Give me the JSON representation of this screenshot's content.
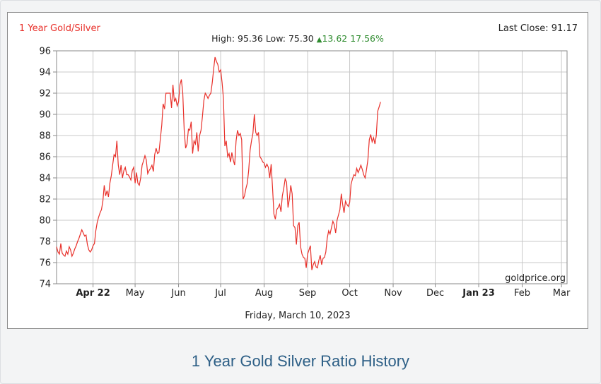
{
  "colors": {
    "line": "#e8302a",
    "grid": "#c8c8c8",
    "up": "#2e8b2e",
    "title": "#e8302a",
    "caption": "#2d5f86"
  },
  "header": {
    "title": "1 Year Gold/Silver",
    "last_close_label": "Last Close:",
    "last_close_value": "91.17",
    "high_label": "High:",
    "high_value": "95.36",
    "low_label": "Low:",
    "low_value": "75.30",
    "change_arrow": "▲",
    "change_value": "13.62",
    "change_pct": "17.56%"
  },
  "watermark": "goldprice.org",
  "date_label": "Friday, March 10, 2023",
  "caption": "1 Year Gold Silver Ratio History",
  "chart_data": {
    "type": "line",
    "title": "1 Year Gold/Silver",
    "xlabel": "Friday, March 10, 2023",
    "ylabel": "",
    "ylim": [
      74,
      96
    ],
    "yticks": [
      74,
      76,
      78,
      80,
      82,
      84,
      86,
      88,
      90,
      92,
      94,
      96
    ],
    "xlim": [
      0,
      364
    ],
    "xtick_labels": [
      {
        "label": "Apr 22",
        "day": 26,
        "bold": true
      },
      {
        "label": "May",
        "day": 56,
        "bold": false
      },
      {
        "label": "Jun",
        "day": 87,
        "bold": false
      },
      {
        "label": "Jul",
        "day": 117,
        "bold": false
      },
      {
        "label": "Aug",
        "day": 148,
        "bold": false
      },
      {
        "label": "Sep",
        "day": 179,
        "bold": false
      },
      {
        "label": "Oct",
        "day": 209,
        "bold": false
      },
      {
        "label": "Nov",
        "day": 240,
        "bold": false
      },
      {
        "label": "Dec",
        "day": 270,
        "bold": false
      },
      {
        "label": "Jan 23",
        "day": 301,
        "bold": true
      },
      {
        "label": "Feb",
        "day": 332,
        "bold": false
      },
      {
        "label": "Mar",
        "day": 360,
        "bold": false
      }
    ],
    "grid": true,
    "series": [
      {
        "points": [
          [
            0,
            77.5
          ],
          [
            1,
            77.0
          ],
          [
            2,
            76.8
          ],
          [
            3,
            77.8
          ],
          [
            4,
            76.9
          ],
          [
            5,
            76.7
          ],
          [
            6,
            76.6
          ],
          [
            7,
            77.1
          ],
          [
            8,
            76.8
          ],
          [
            9,
            77.5
          ],
          [
            10,
            77.2
          ],
          [
            11,
            76.6
          ],
          [
            12,
            76.9
          ],
          [
            13,
            77.3
          ],
          [
            14,
            77.6
          ],
          [
            15,
            78.0
          ],
          [
            16,
            78.3
          ],
          [
            17,
            78.7
          ],
          [
            18,
            79.1
          ],
          [
            19,
            78.8
          ],
          [
            20,
            78.5
          ],
          [
            21,
            78.6
          ],
          [
            22,
            77.7
          ],
          [
            23,
            77.2
          ],
          [
            24,
            77.0
          ],
          [
            25,
            77.2
          ],
          [
            26,
            77.6
          ],
          [
            27,
            77.8
          ],
          [
            28,
            79.0
          ],
          [
            29,
            79.8
          ],
          [
            30,
            80.3
          ],
          [
            31,
            80.7
          ],
          [
            32,
            81.0
          ],
          [
            33,
            81.8
          ],
          [
            34,
            83.3
          ],
          [
            35,
            82.3
          ],
          [
            36,
            82.8
          ],
          [
            37,
            82.2
          ],
          [
            38,
            83.5
          ],
          [
            39,
            84.2
          ],
          [
            40,
            85.2
          ],
          [
            41,
            86.2
          ],
          [
            42,
            86.0
          ],
          [
            43,
            87.5
          ],
          [
            44,
            85.2
          ],
          [
            45,
            84.3
          ],
          [
            46,
            85.2
          ],
          [
            47,
            84.0
          ],
          [
            48,
            84.7
          ],
          [
            49,
            85.0
          ],
          [
            50,
            84.3
          ],
          [
            51,
            84.3
          ],
          [
            52,
            84.1
          ],
          [
            53,
            83.8
          ],
          [
            54,
            84.7
          ],
          [
            55,
            85.0
          ],
          [
            56,
            83.5
          ],
          [
            57,
            84.5
          ],
          [
            58,
            83.5
          ],
          [
            59,
            83.3
          ],
          [
            60,
            84.0
          ],
          [
            61,
            85.2
          ],
          [
            62,
            85.6
          ],
          [
            63,
            86.1
          ],
          [
            64,
            85.7
          ],
          [
            65,
            84.4
          ],
          [
            66,
            84.7
          ],
          [
            67,
            84.9
          ],
          [
            68,
            85.2
          ],
          [
            69,
            84.6
          ],
          [
            70,
            86.2
          ],
          [
            71,
            86.8
          ],
          [
            72,
            86.3
          ],
          [
            73,
            86.4
          ],
          [
            74,
            87.7
          ],
          [
            75,
            89.0
          ],
          [
            76,
            91.0
          ],
          [
            77,
            90.5
          ],
          [
            78,
            92.0
          ],
          [
            79,
            92.0
          ],
          [
            80,
            92.0
          ],
          [
            81,
            92.0
          ],
          [
            82,
            90.6
          ],
          [
            83,
            92.8
          ],
          [
            84,
            91.2
          ],
          [
            85,
            91.5
          ],
          [
            86,
            90.8
          ],
          [
            87,
            91.2
          ],
          [
            88,
            92.8
          ],
          [
            89,
            93.3
          ],
          [
            90,
            92.0
          ],
          [
            91,
            88.5
          ],
          [
            92,
            86.8
          ],
          [
            93,
            87.2
          ],
          [
            94,
            88.6
          ],
          [
            95,
            88.5
          ],
          [
            96,
            89.3
          ],
          [
            97,
            86.3
          ],
          [
            98,
            87.5
          ],
          [
            99,
            87.2
          ],
          [
            100,
            88.3
          ],
          [
            101,
            86.5
          ],
          [
            102,
            88.0
          ],
          [
            103,
            88.5
          ],
          [
            104,
            89.8
          ],
          [
            105,
            91.3
          ],
          [
            106,
            92.0
          ],
          [
            107,
            91.8
          ],
          [
            108,
            91.5
          ],
          [
            109,
            91.8
          ],
          [
            110,
            92.0
          ],
          [
            111,
            93.0
          ],
          [
            112,
            94.3
          ],
          [
            113,
            95.4
          ],
          [
            114,
            95.0
          ],
          [
            115,
            94.7
          ],
          [
            116,
            94.0
          ],
          [
            117,
            94.2
          ],
          [
            118,
            93.0
          ],
          [
            119,
            91.5
          ],
          [
            120,
            87.0
          ],
          [
            121,
            87.5
          ],
          [
            122,
            86.0
          ],
          [
            123,
            86.3
          ],
          [
            124,
            85.5
          ],
          [
            125,
            86.4
          ],
          [
            126,
            85.7
          ],
          [
            127,
            85.2
          ],
          [
            128,
            87.5
          ],
          [
            129,
            88.5
          ],
          [
            130,
            88.0
          ],
          [
            131,
            88.2
          ],
          [
            132,
            87.6
          ],
          [
            133,
            82.0
          ],
          [
            134,
            82.3
          ],
          [
            135,
            83.0
          ],
          [
            136,
            83.5
          ],
          [
            137,
            84.7
          ],
          [
            138,
            86.6
          ],
          [
            139,
            87.5
          ],
          [
            140,
            88.2
          ],
          [
            141,
            90.0
          ],
          [
            142,
            88.3
          ],
          [
            143,
            88.0
          ],
          [
            144,
            88.3
          ],
          [
            145,
            86.0
          ],
          [
            146,
            85.8
          ],
          [
            147,
            85.5
          ],
          [
            148,
            85.4
          ],
          [
            149,
            85.0
          ],
          [
            150,
            85.3
          ],
          [
            151,
            85.0
          ],
          [
            152,
            84.0
          ],
          [
            153,
            85.3
          ],
          [
            154,
            83.0
          ],
          [
            155,
            80.6
          ],
          [
            156,
            80.1
          ],
          [
            157,
            81.0
          ],
          [
            158,
            81.2
          ],
          [
            159,
            81.5
          ],
          [
            160,
            80.8
          ],
          [
            161,
            82.3
          ],
          [
            162,
            83.0
          ],
          [
            163,
            83.9
          ],
          [
            164,
            83.6
          ],
          [
            165,
            81.2
          ],
          [
            166,
            82.0
          ],
          [
            167,
            83.3
          ],
          [
            168,
            82.5
          ],
          [
            169,
            79.5
          ],
          [
            170,
            79.3
          ],
          [
            171,
            77.7
          ],
          [
            172,
            79.5
          ],
          [
            173,
            79.8
          ],
          [
            174,
            77.5
          ],
          [
            175,
            76.8
          ],
          [
            176,
            76.5
          ],
          [
            177,
            76.4
          ],
          [
            178,
            75.5
          ],
          [
            179,
            76.8
          ],
          [
            180,
            77.2
          ],
          [
            181,
            77.6
          ],
          [
            182,
            75.3
          ],
          [
            183,
            75.8
          ],
          [
            184,
            76.1
          ],
          [
            185,
            75.6
          ],
          [
            186,
            75.5
          ],
          [
            187,
            76.2
          ],
          [
            188,
            76.7
          ],
          [
            189,
            75.8
          ],
          [
            190,
            76.4
          ],
          [
            191,
            76.5
          ],
          [
            192,
            77.0
          ],
          [
            193,
            78.3
          ],
          [
            194,
            79.0
          ],
          [
            195,
            78.7
          ],
          [
            196,
            79.3
          ],
          [
            197,
            79.9
          ],
          [
            198,
            79.6
          ],
          [
            199,
            78.8
          ],
          [
            200,
            80.0
          ],
          [
            201,
            80.5
          ],
          [
            202,
            81.0
          ],
          [
            203,
            82.5
          ],
          [
            204,
            81.5
          ],
          [
            205,
            80.7
          ],
          [
            206,
            81.8
          ],
          [
            207,
            81.5
          ],
          [
            208,
            81.3
          ],
          [
            209,
            81.7
          ],
          [
            210,
            83.4
          ],
          [
            211,
            83.9
          ],
          [
            212,
            84.3
          ],
          [
            213,
            84.2
          ],
          [
            214,
            84.9
          ],
          [
            215,
            84.5
          ],
          [
            216,
            84.8
          ],
          [
            217,
            85.2
          ],
          [
            218,
            84.8
          ],
          [
            219,
            84.3
          ],
          [
            220,
            84.0
          ],
          [
            221,
            84.8
          ],
          [
            222,
            85.7
          ],
          [
            223,
            87.6
          ],
          [
            224,
            88.1
          ],
          [
            225,
            87.4
          ],
          [
            226,
            87.8
          ],
          [
            227,
            87.2
          ],
          [
            228,
            88.0
          ],
          [
            229,
            90.3
          ],
          [
            230,
            90.7
          ],
          [
            231,
            91.17
          ]
        ]
      }
    ]
  }
}
